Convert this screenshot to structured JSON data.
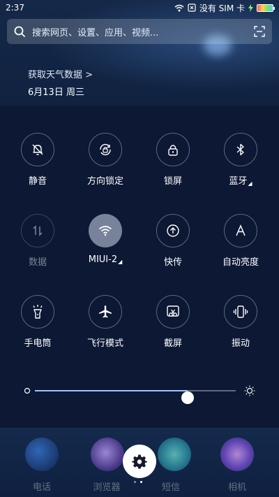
{
  "status_bar": {
    "time": "2:37",
    "sim_text": "没有 SIM 卡",
    "icons": [
      "wifi-icon",
      "no-sim-icon",
      "charging-icon",
      "battery-icon"
    ]
  },
  "search": {
    "placeholder": "搜索网页、设置、应用、视频..."
  },
  "weather": {
    "link": "获取天气数据 >",
    "date": "6月13日 周三"
  },
  "toggles": [
    {
      "label": "静音",
      "icon": "bell-off-icon",
      "state": "off"
    },
    {
      "label": "方向锁定",
      "icon": "rotation-lock-icon",
      "state": "off"
    },
    {
      "label": "锁屏",
      "icon": "lock-icon",
      "state": "off"
    },
    {
      "label": "蓝牙",
      "icon": "bluetooth-icon",
      "state": "off",
      "has_menu": true
    },
    {
      "label": "数据",
      "icon": "mobile-data-icon",
      "state": "disabled"
    },
    {
      "label": "MIUI-2",
      "icon": "wifi-icon",
      "state": "on",
      "has_menu": true
    },
    {
      "label": "快传",
      "icon": "quick-share-icon",
      "state": "off"
    },
    {
      "label": "自动亮度",
      "icon": "auto-brightness-icon",
      "state": "off"
    },
    {
      "label": "手电筒",
      "icon": "flashlight-icon",
      "state": "off"
    },
    {
      "label": "飞行模式",
      "icon": "airplane-icon",
      "state": "off"
    },
    {
      "label": "截屏",
      "icon": "screenshot-icon",
      "state": "off"
    },
    {
      "label": "振动",
      "icon": "vibrate-icon",
      "state": "off"
    }
  ],
  "brightness": {
    "level": 0.76
  },
  "dock": {
    "apps": [
      "电话",
      "浏览器",
      "短信",
      "相机"
    ]
  },
  "colors": {
    "panel_bg": "#0c1834",
    "active_toggle": "#c8d2e6",
    "slider_fill": "#9ec4ff"
  }
}
